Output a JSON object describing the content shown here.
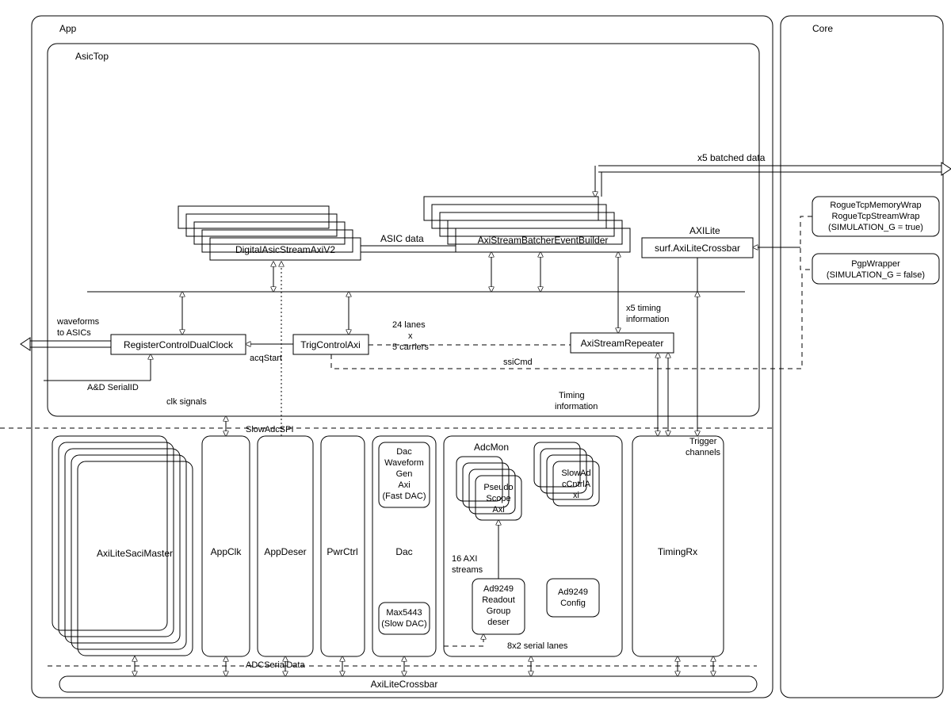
{
  "containers": {
    "app": "App",
    "core": "Core",
    "asicTop": "AsicTop"
  },
  "asicTopBlocks": {
    "digitalAsicStream": "DigitalAsicStreamAxiV2",
    "batcher": "AxiStreamBatcherEventBuilder",
    "surfCrossbar": "surf.AxiLiteCrossbar",
    "registerControl": "RegisterControlDualClock",
    "trigControl": "TrigControlAxi",
    "axiStreamRepeater": "AxiStreamRepeater"
  },
  "appBlocks": {
    "axiLiteSaciMaster": "AxiLiteSaciMaster",
    "appClk": "AppClk",
    "appDeser": "AppDeser",
    "pwrCtrl": "PwrCtrl",
    "dac": "Dac",
    "dacWaveformGen": [
      "Dac",
      "Waveform",
      "Gen",
      "Axi",
      "(Fast DAC)"
    ],
    "max5443": [
      "Max5443",
      "(Slow DAC)"
    ],
    "adcMon": "AdcMon",
    "pseudoScope": [
      "Pseudo",
      "Scope",
      "Axi"
    ],
    "slowAdcCntrl": [
      "SlowAd",
      "cCntrlA",
      "xi"
    ],
    "ad9249Readout": [
      "Ad9249",
      "Readout",
      "Group",
      "deser"
    ],
    "ad9249Config": [
      "Ad9249",
      "Config"
    ],
    "timingRx": "TimingRx",
    "axiLiteCrossbar": "AxiLiteCrossbar"
  },
  "coreBlocks": {
    "rogueWrap": [
      "RogueTcpMemoryWrap",
      "RogueTcpStreamWrap",
      "(SIMULATION_G = true)"
    ],
    "pgpWrapper": [
      "PgpWrapper",
      "(SIMULATION_G = false)"
    ]
  },
  "labels": {
    "asicData": "ASIC data",
    "batchedData": "x5 batched data",
    "axiLite": "AXILite",
    "timingInfoX5": [
      "x5 timing",
      "information"
    ],
    "waveforms": [
      "waveforms",
      "to ASICs"
    ],
    "adSerialId": "A&D SerialID",
    "acqStart": "acqStart",
    "lanes": [
      "24 lanes",
      "x",
      "5 carriers"
    ],
    "ssiCmd": "ssiCmd",
    "clkSignals": "clk signals",
    "slowAdcSpi": "SlowAdcSPI",
    "timingInfo": [
      "Timing",
      "information"
    ],
    "triggerChannels": [
      "Trigger",
      "channels"
    ],
    "axiStreams16": [
      "16 AXI",
      "streams"
    ],
    "serialLanes": "8x2 serial lanes",
    "adcSerialData": "ADCSerialData"
  }
}
